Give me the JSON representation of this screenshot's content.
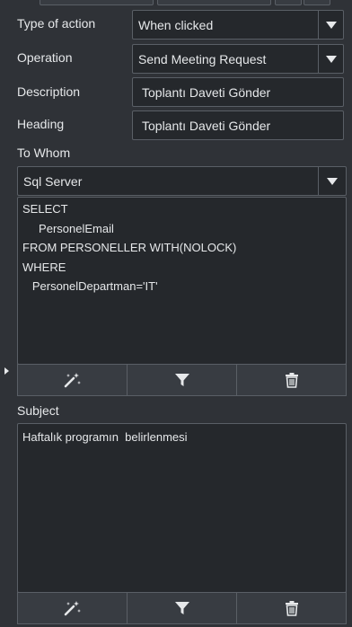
{
  "type_of_action": {
    "label": "Type of action",
    "value": "When clicked"
  },
  "operation": {
    "label": "Operation",
    "value": "Send Meeting Request"
  },
  "description": {
    "label": "Description",
    "value": "Toplantı Daveti Gönder"
  },
  "heading": {
    "label": "Heading",
    "value": "Toplantı Daveti Gönder"
  },
  "to_whom": {
    "label": "To Whom",
    "source": "Sql Server",
    "query_lines": [
      "SELECT",
      "     PersonelEmail",
      "FROM PERSONELLER WITH(NOLOCK)",
      "WHERE",
      "   PersonelDepartman='IT'"
    ]
  },
  "subject": {
    "label": "Subject",
    "text": "Haftalık programın  belirlenmesi"
  },
  "toolbar_icons": [
    "magic-wand-icon",
    "filter-icon",
    "trash-icon"
  ]
}
